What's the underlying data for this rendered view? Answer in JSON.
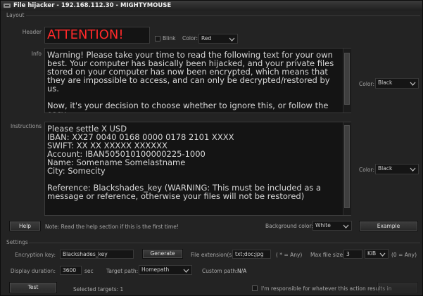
{
  "window": {
    "title": "File hijacker - 192.168.112.30 - MIGHTYMOUSE"
  },
  "layout_group": {
    "label": "Layout",
    "header_label": "Header",
    "header_text": "ATTENTION!",
    "header_text_color": "#ff2a2a",
    "blink_label": "Blink",
    "blink_checked": false,
    "header_color_label": "Color:",
    "header_color_value": "Red",
    "info_label": "Info",
    "info_text": "Warning! Please take your time to read the following text for your own best. Your computer has basically been hijacked, and your private files stored on your computer has now been encrypted, which means that they are impossible to access, and can only be decrypted/restored by us.\n\nNow, it's your decision to choose whether to ignore this, or follow the easy",
    "info_color_label": "Color:",
    "info_color_value": "Black",
    "instructions_label": "Instructions",
    "instructions_text": "Please settle X USD\nIBAN: XX27 0040 0168 0000 0178 2101 XXXX\nSWIFT: XX XX XXXXX XXXXXX\nAccount: IBAN505010100000225-1000\nName: Somename Somelastname\nCity: Somecity\n\nReference: Blackshades_key (WARNING: This must be included as a message or reference, otherwise your files will not be restored)",
    "instructions_color_label": "Color:",
    "instructions_color_value": "Black",
    "help_button": "Help",
    "help_note": "Note: Read the help section if this is the first time!",
    "background_color_label": "Background color:",
    "background_color_value": "White",
    "example_button": "Example"
  },
  "settings_group": {
    "label": "Settings",
    "encryption_key_label": "Encryption key:",
    "encryption_key_value": "Blackshades_key",
    "generate_button": "Generate",
    "file_extensions_label": "File extension(s):",
    "file_extensions_value": "txt;doc;jpg",
    "file_extensions_hint": "( * = Any)",
    "max_file_size_label": "Max file size:",
    "max_file_size_value": "3",
    "max_file_size_unit": "KiB",
    "max_file_size_hint": "(0 = Any)",
    "display_duration_label": "Display duration:",
    "display_duration_value": "3600",
    "display_duration_unit": "sec",
    "target_path_label": "Target path:",
    "target_path_value": "Homepath",
    "custom_path_label": "Custom path:",
    "custom_path_value": "N/A"
  },
  "footer": {
    "test_button": "Test",
    "selected_targets": "Selected targets: 1",
    "responsibility_label": "I'm responsible for whatever this action results in",
    "responsibility_checked": false
  }
}
